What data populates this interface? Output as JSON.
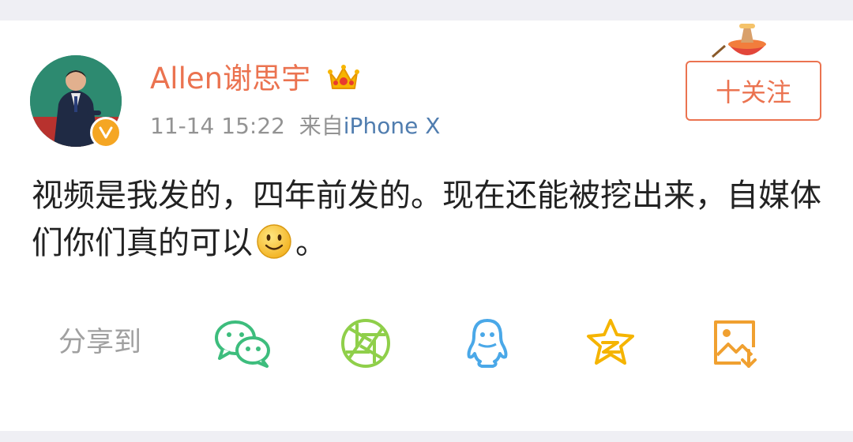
{
  "post": {
    "author_name": "Allen谢思宇",
    "timestamp": "11-14 15:22",
    "source_prefix": "来自",
    "source_device": "iPhone X",
    "follow_label": "十关注",
    "content_main": "视频是我发的，四年前发的。现在还能被挖出来，自媒体们你们真的可以",
    "content_end": "。",
    "emoji": "smile-emoji"
  },
  "share": {
    "label": "分享到",
    "targets": [
      {
        "name": "wechat-icon"
      },
      {
        "name": "moments-icon"
      },
      {
        "name": "qq-icon"
      },
      {
        "name": "qzone-icon"
      },
      {
        "name": "save-image-icon"
      }
    ]
  },
  "colors": {
    "accent": "#eb7350",
    "link": "#507daf",
    "wechat": "#3dbd7d",
    "moments": "#8fcf4a",
    "qq": "#4aa8e8",
    "qzone": "#f5b400",
    "save": "#f0a030"
  }
}
